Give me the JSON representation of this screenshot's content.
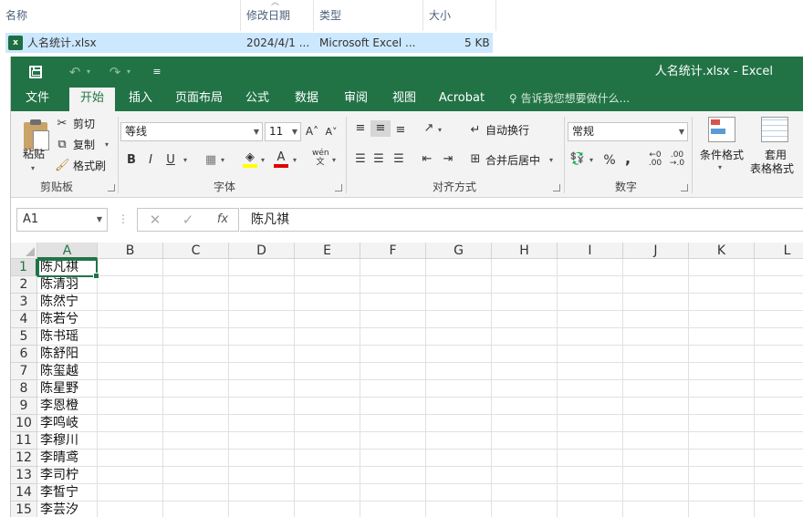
{
  "explorer": {
    "columns": [
      "名称",
      "修改日期",
      "类型",
      "大小"
    ],
    "file": {
      "name": "人名统计.xlsx",
      "modified": "2024/4/1 ...",
      "type": "Microsoft Excel ...",
      "size": "5 KB"
    }
  },
  "excel": {
    "title": "人名统计.xlsx - Excel",
    "tabs": [
      "文件",
      "开始",
      "插入",
      "页面布局",
      "公式",
      "数据",
      "审阅",
      "视图",
      "Acrobat"
    ],
    "active_tab": "开始",
    "tell_me": "告诉我您想要做什么...",
    "ribbon": {
      "clipboard": {
        "paste": "粘贴",
        "cut": "剪切",
        "copy": "复制",
        "format_painter": "格式刷",
        "label": "剪贴板"
      },
      "font": {
        "family": "等线",
        "size": "11",
        "bold": "B",
        "italic": "I",
        "underline": "U",
        "pinyin": "wén",
        "label": "字体"
      },
      "alignment": {
        "wrap": "自动换行",
        "merge": "合并后居中",
        "label": "对齐方式"
      },
      "number": {
        "format": "常规",
        "percent": "%",
        "comma": ",",
        "label": "数字"
      },
      "styles": {
        "conditional": "条件格式",
        "table_line1": "套用",
        "table_line2": "表格格式"
      }
    },
    "formula_bar": {
      "name_box": "A1",
      "fx": "fx",
      "value": "陈凡祺"
    },
    "columns": [
      "A",
      "B",
      "C",
      "D",
      "E",
      "F",
      "G",
      "H",
      "I",
      "J",
      "K",
      "L"
    ],
    "rows": [
      {
        "n": "1",
        "a": "陈凡祺"
      },
      {
        "n": "2",
        "a": "陈清羽"
      },
      {
        "n": "3",
        "a": "陈然宁"
      },
      {
        "n": "4",
        "a": "陈若兮"
      },
      {
        "n": "5",
        "a": "陈书瑶"
      },
      {
        "n": "6",
        "a": "陈舒阳"
      },
      {
        "n": "7",
        "a": "陈玺越"
      },
      {
        "n": "8",
        "a": "陈星野"
      },
      {
        "n": "9",
        "a": "李恩橙"
      },
      {
        "n": "10",
        "a": "李鸣岐"
      },
      {
        "n": "11",
        "a": "李穆川"
      },
      {
        "n": "12",
        "a": "李晴鸢"
      },
      {
        "n": "13",
        "a": "李司柠"
      },
      {
        "n": "14",
        "a": "李皙宁"
      },
      {
        "n": "15",
        "a": "李芸汐"
      }
    ]
  }
}
